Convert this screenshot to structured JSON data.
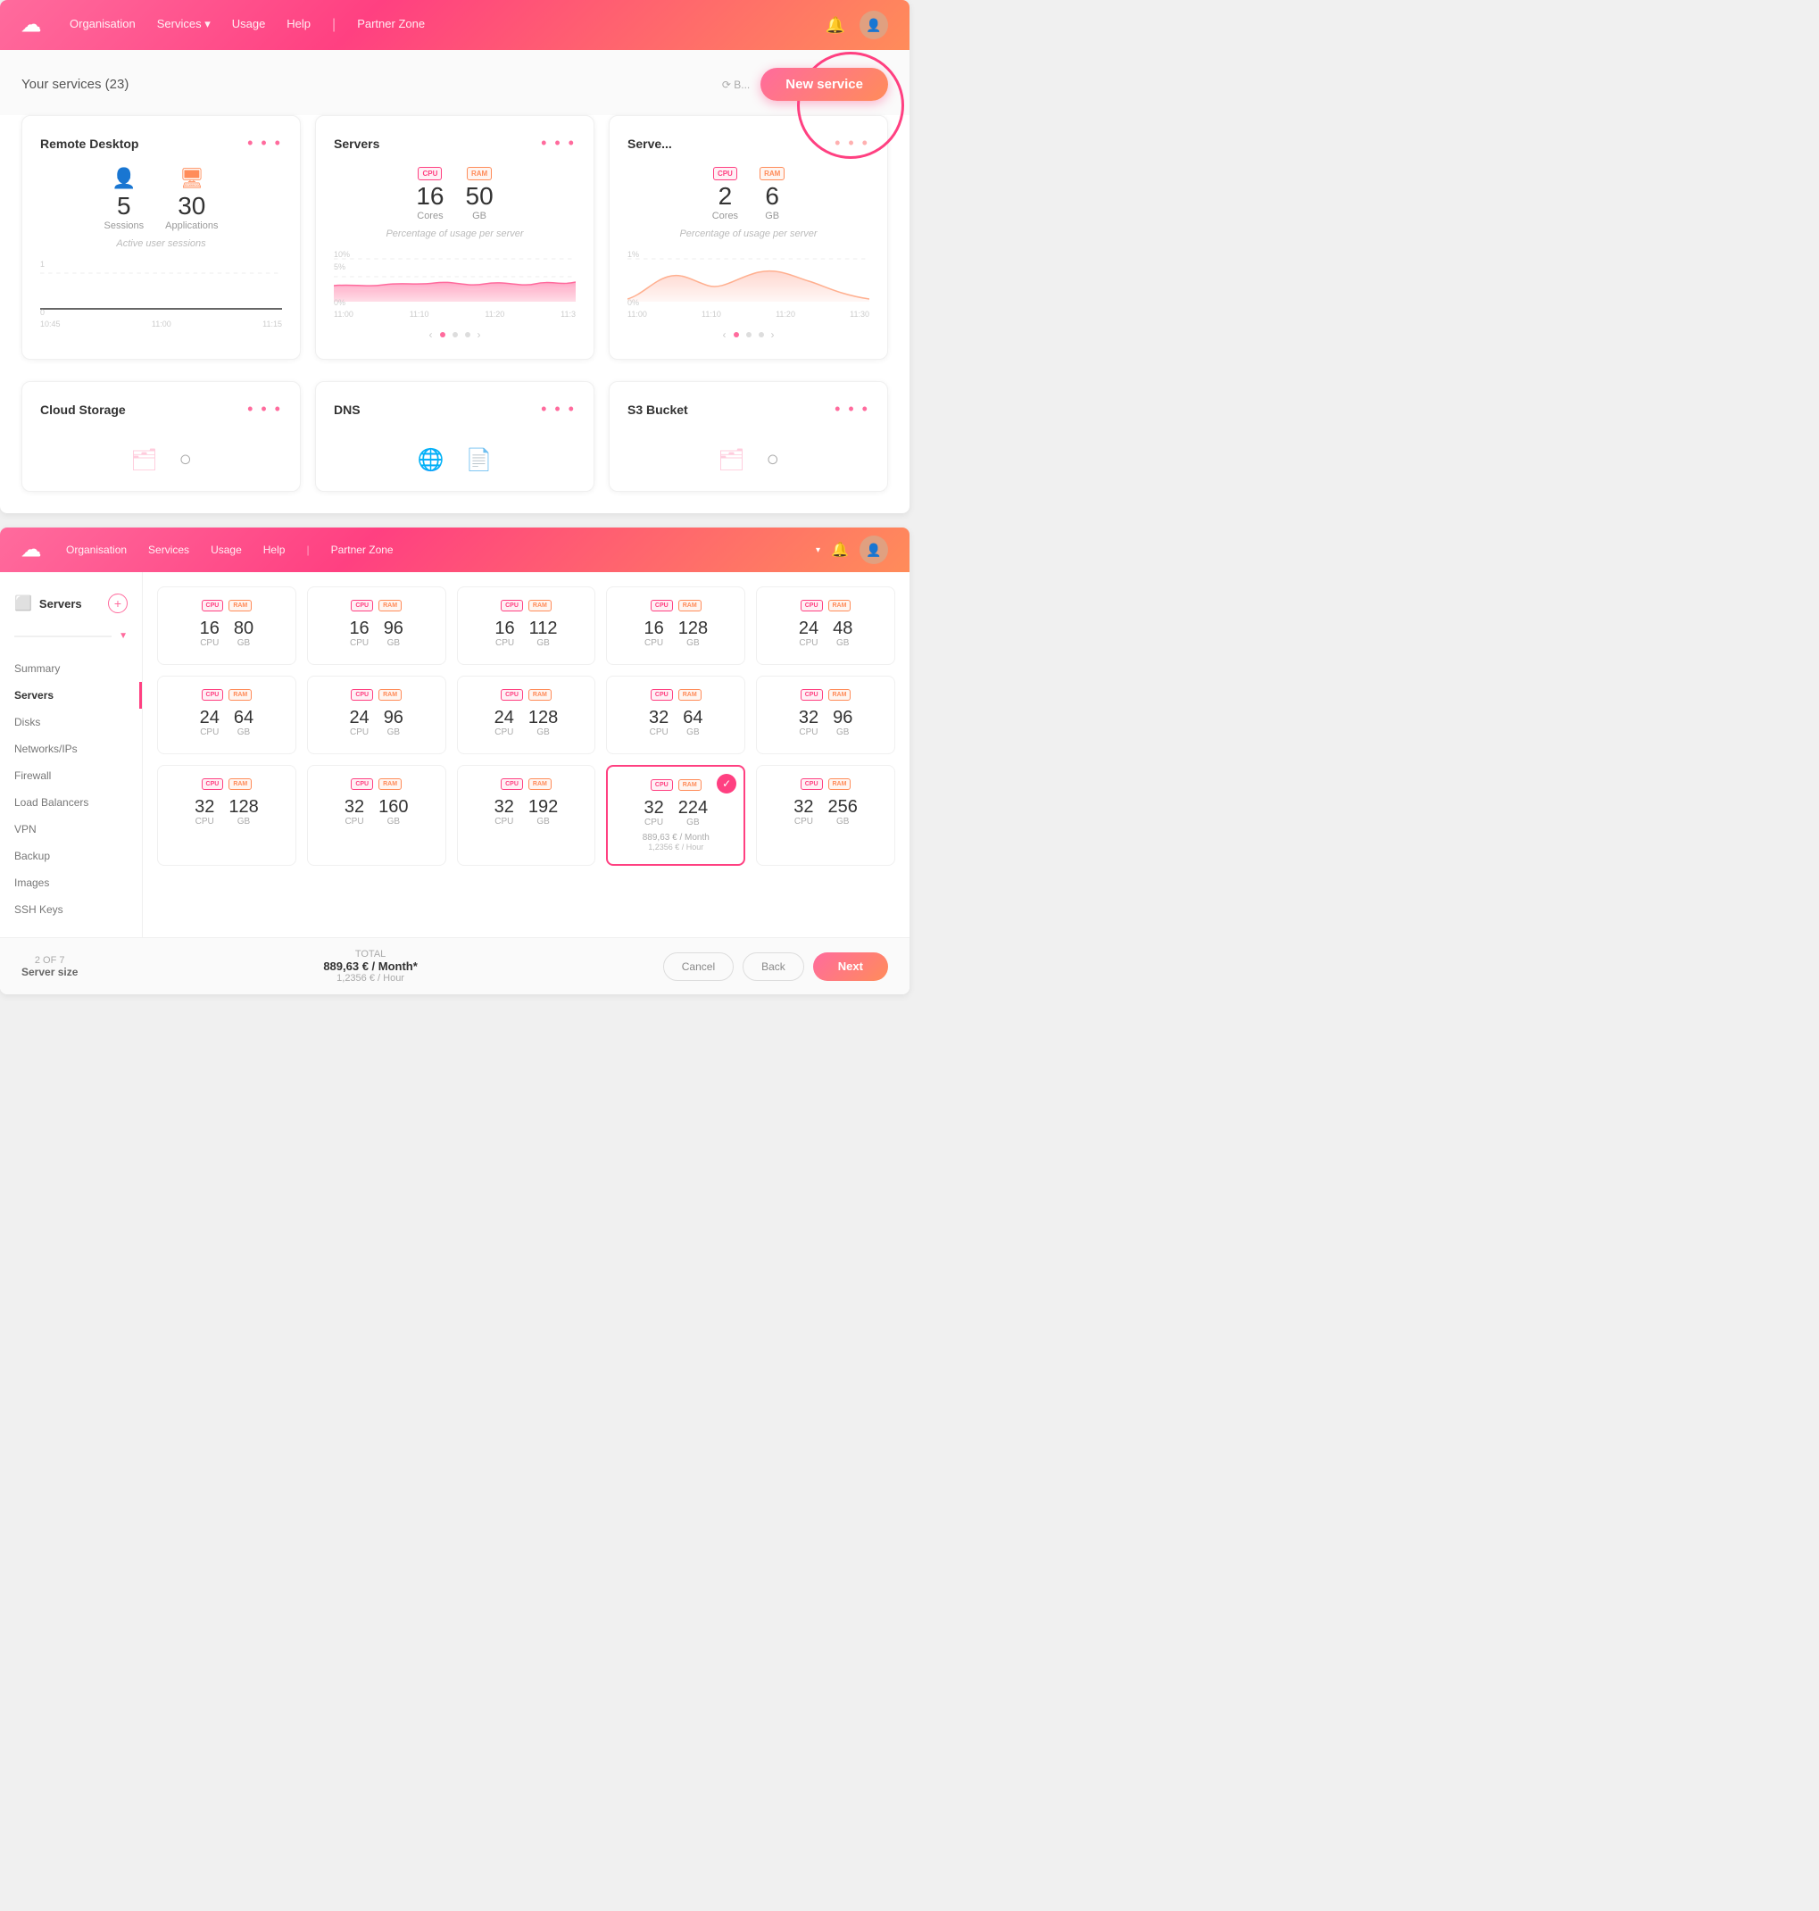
{
  "app": {
    "logo": "☁",
    "nav": {
      "links": [
        "Organisation",
        "Services",
        "Usage",
        "Help",
        "|",
        "Partner Zone"
      ],
      "services_arrow": true
    }
  },
  "top": {
    "header": {
      "title": "Your services (23)",
      "new_service_btn": "New service"
    },
    "cards": [
      {
        "id": "remote-desktop",
        "title": "Remote Desktop",
        "stats": [
          {
            "icon": "👤",
            "value": "5",
            "label": "Sessions"
          },
          {
            "icon": "🖥",
            "value": "30",
            "label": "Applications"
          }
        ],
        "subtitle": "Active user sessions",
        "chart": {
          "top_label": "1",
          "bottom_label": "0",
          "times": [
            "10:45",
            "11:00",
            "11:15"
          ],
          "type": "flat"
        }
      },
      {
        "id": "servers",
        "title": "Servers",
        "stats": [
          {
            "icon": "cpu",
            "value": "16",
            "label": "Cores"
          },
          {
            "icon": "ram",
            "value": "50",
            "label": "GB"
          }
        ],
        "subtitle": "Percentage of usage per server",
        "chart": {
          "top_label": "10%",
          "bottom_label": "0%",
          "top2_label": "5%",
          "times": [
            "11:00",
            "11:10",
            "11:20",
            "11:3"
          ],
          "type": "wavy"
        }
      },
      {
        "id": "serverless",
        "title": "Serve...",
        "stats": [
          {
            "icon": "cpu",
            "value": "2",
            "label": "Cores"
          },
          {
            "icon": "ram",
            "value": "6",
            "label": "GB"
          }
        ],
        "subtitle": "Percentage of usage per server",
        "chart": {
          "top_label": "1%",
          "bottom_label": "0%",
          "times": [
            "11:00",
            "11:10",
            "11:20",
            "11:30"
          ],
          "type": "bumpy"
        }
      }
    ],
    "bottom_cards": [
      {
        "title": "Cloud Storage"
      },
      {
        "title": "DNS"
      },
      {
        "title": "S3 Bucket"
      }
    ]
  },
  "bottom": {
    "nav": {
      "links": [
        "Organisation",
        "Services",
        "Usage",
        "Help",
        "|",
        "Partner Zone"
      ]
    },
    "sidebar": {
      "service_title": "Servers",
      "menu_items": [
        {
          "label": "Summary",
          "active": false
        },
        {
          "label": "Servers",
          "active": true
        },
        {
          "label": "Disks",
          "active": false
        },
        {
          "label": "Networks/IPs",
          "active": false
        },
        {
          "label": "Firewall",
          "active": false
        },
        {
          "label": "Load Balancers",
          "active": false
        },
        {
          "label": "VPN",
          "active": false
        },
        {
          "label": "Backup",
          "active": false
        },
        {
          "label": "Images",
          "active": false
        },
        {
          "label": "SSH Keys",
          "active": false
        }
      ]
    },
    "server_sizes": [
      [
        {
          "cpu": "16",
          "gb": "80",
          "selected": false
        },
        {
          "cpu": "16",
          "gb": "96",
          "selected": false
        },
        {
          "cpu": "16",
          "gb": "112",
          "selected": false
        },
        {
          "cpu": "16",
          "gb": "128",
          "selected": false
        },
        {
          "cpu": "24",
          "gb": "48",
          "selected": false
        }
      ],
      [
        {
          "cpu": "24",
          "gb": "64",
          "selected": false
        },
        {
          "cpu": "24",
          "gb": "96",
          "selected": false
        },
        {
          "cpu": "24",
          "gb": "128",
          "selected": false
        },
        {
          "cpu": "32",
          "gb": "64",
          "selected": false
        },
        {
          "cpu": "32",
          "gb": "96",
          "selected": false
        }
      ],
      [
        {
          "cpu": "32",
          "gb": "128",
          "selected": false
        },
        {
          "cpu": "32",
          "gb": "160",
          "selected": false
        },
        {
          "cpu": "32",
          "gb": "192",
          "selected": false
        },
        {
          "cpu": "32",
          "gb": "224",
          "selected": true,
          "price_month": "889,63 € / Month",
          "price_hour": "1,2356 € / Hour"
        },
        {
          "cpu": "32",
          "gb": "256",
          "selected": false
        }
      ]
    ],
    "wizard": {
      "step": "2 OF 7",
      "step_name": "Server size",
      "total_label": "TOTAL",
      "total_month": "889,63 € / Month*",
      "total_hour": "1,2356 € / Hour",
      "btn_cancel": "Cancel",
      "btn_back": "Back",
      "btn_next": "Next"
    }
  }
}
